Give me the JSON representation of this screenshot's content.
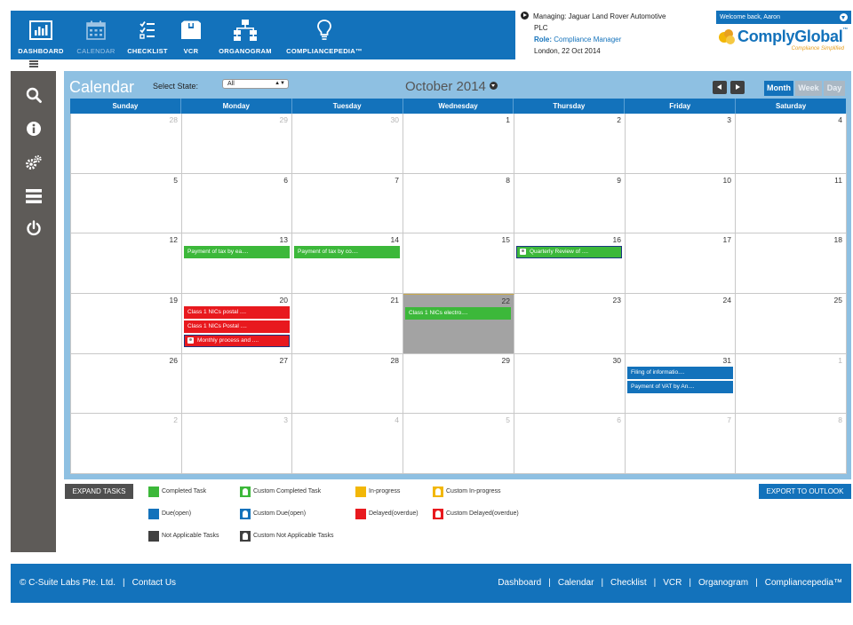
{
  "nav": [
    {
      "label": "DASHBOARD",
      "icon": "bar-chart-icon"
    },
    {
      "label": "CALENDAR",
      "icon": "calendar-icon"
    },
    {
      "label": "CHECKLIST",
      "icon": "checklist-icon"
    },
    {
      "label": "VCR",
      "icon": "box-icon"
    },
    {
      "label": "ORGANOGRAM",
      "icon": "org-chart-icon"
    },
    {
      "label": "COMPLIANCEPEDIA™",
      "icon": "lightbulb-icon"
    }
  ],
  "header": {
    "managing_line1": "Managing: Jaguar Land Rover Automotive",
    "managing_line2": "PLC",
    "role_label": "Role:",
    "role_value": "Compliance Manager",
    "location_date": "London, 22 Oct 2014",
    "welcome": "Welcome back, Aaron",
    "brand": "ComplyGlobal",
    "brand_tm": "™",
    "tagline": "Compliance Simplified"
  },
  "sidebar": [
    {
      "icon": "search-icon"
    },
    {
      "icon": "info-icon"
    },
    {
      "icon": "settings-gears-icon"
    },
    {
      "icon": "list-icon"
    },
    {
      "icon": "power-icon"
    }
  ],
  "calendar": {
    "title": "Calendar",
    "state_label": "Select State:",
    "state_value": "All",
    "month_title": "October 2014",
    "views": [
      "Month",
      "Week",
      "Day"
    ],
    "active_view": "Month",
    "weekdays": [
      "Sunday",
      "Monday",
      "Tuesday",
      "Wednesday",
      "Thursday",
      "Friday",
      "Saturday"
    ],
    "weeks": [
      [
        {
          "day": "28",
          "other": true
        },
        {
          "day": "29",
          "other": true
        },
        {
          "day": "30",
          "other": true
        },
        {
          "day": "1"
        },
        {
          "day": "2"
        },
        {
          "day": "3"
        },
        {
          "day": "4"
        }
      ],
      [
        {
          "day": "5"
        },
        {
          "day": "6"
        },
        {
          "day": "7"
        },
        {
          "day": "8"
        },
        {
          "day": "9"
        },
        {
          "day": "10"
        },
        {
          "day": "11"
        }
      ],
      [
        {
          "day": "12"
        },
        {
          "day": "13",
          "events": [
            {
              "text": "Payment of tax by ea....",
              "color": "green"
            }
          ]
        },
        {
          "day": "14",
          "events": [
            {
              "text": "Payment of tax by co....",
              "color": "green"
            }
          ]
        },
        {
          "day": "15"
        },
        {
          "day": "16",
          "events": [
            {
              "text": "Quarterly Review of ....",
              "color": "green",
              "custom": true
            }
          ]
        },
        {
          "day": "17"
        },
        {
          "day": "18"
        }
      ],
      [
        {
          "day": "19"
        },
        {
          "day": "20",
          "events": [
            {
              "text": "Class 1 NICs postal ....",
              "color": "red"
            },
            {
              "text": "Class 1 NICs Postal ....",
              "color": "red"
            },
            {
              "text": "Monthly process and ....",
              "color": "red",
              "custom": true
            }
          ]
        },
        {
          "day": "21"
        },
        {
          "day": "22",
          "today": true,
          "events": [
            {
              "text": "Class 1 NICs electro....",
              "color": "green"
            }
          ]
        },
        {
          "day": "23"
        },
        {
          "day": "24"
        },
        {
          "day": "25"
        }
      ],
      [
        {
          "day": "26"
        },
        {
          "day": "27"
        },
        {
          "day": "28"
        },
        {
          "day": "29"
        },
        {
          "day": "30"
        },
        {
          "day": "31",
          "events": [
            {
              "text": "Filing of informatio....",
              "color": "blue"
            },
            {
              "text": "Payment of VAT by An....",
              "color": "blue"
            }
          ]
        },
        {
          "day": "1",
          "other": true
        }
      ],
      [
        {
          "day": "2",
          "other": true
        },
        {
          "day": "3",
          "other": true
        },
        {
          "day": "4",
          "other": true
        },
        {
          "day": "5",
          "other": true
        },
        {
          "day": "6",
          "other": true
        },
        {
          "day": "7",
          "other": true
        },
        {
          "day": "8",
          "other": true
        }
      ]
    ]
  },
  "legend": {
    "expand_label": "EXPAND TASKS",
    "export_label": "EXPORT TO OUTLOOK",
    "items": [
      {
        "label": "Completed Task",
        "color": "#3cb83a",
        "custom": false
      },
      {
        "label": "Custom Completed Task",
        "color": "#3cb83a",
        "custom": true
      },
      {
        "label": "In-progress",
        "color": "#f2b707",
        "custom": false
      },
      {
        "label": "Custom In-progress",
        "color": "#f2b707",
        "custom": true
      },
      {
        "label": "Due(open)",
        "color": "#1372bb",
        "custom": false
      },
      {
        "label": "Custom Due(open)",
        "color": "#1372bb",
        "custom": true
      },
      {
        "label": "Delayed(overdue)",
        "color": "#e8191e",
        "custom": false
      },
      {
        "label": "Custom Delayed(overdue)",
        "color": "#e8191e",
        "custom": true
      },
      {
        "label": "Not Applicable Tasks",
        "color": "#3f3f3f",
        "custom": false
      },
      {
        "label": "Custom Not Applicable Tasks",
        "color": "#3f3f3f",
        "custom": true
      }
    ]
  },
  "footer": {
    "copyright": "© C-Suite Labs Pte. Ltd.",
    "separator": "|",
    "contact": "Contact Us",
    "links": [
      "Dashboard",
      "Calendar",
      "Checklist",
      "VCR",
      "Organogram",
      "Compliancepedia™"
    ]
  },
  "colors": {
    "primary": "#1372bb",
    "panel": "#8ec0e2",
    "sidebar": "#5e5b58",
    "completed": "#3cb83a",
    "delayed": "#e8191e",
    "in_progress": "#f2b707",
    "accent": "#e8a020"
  }
}
